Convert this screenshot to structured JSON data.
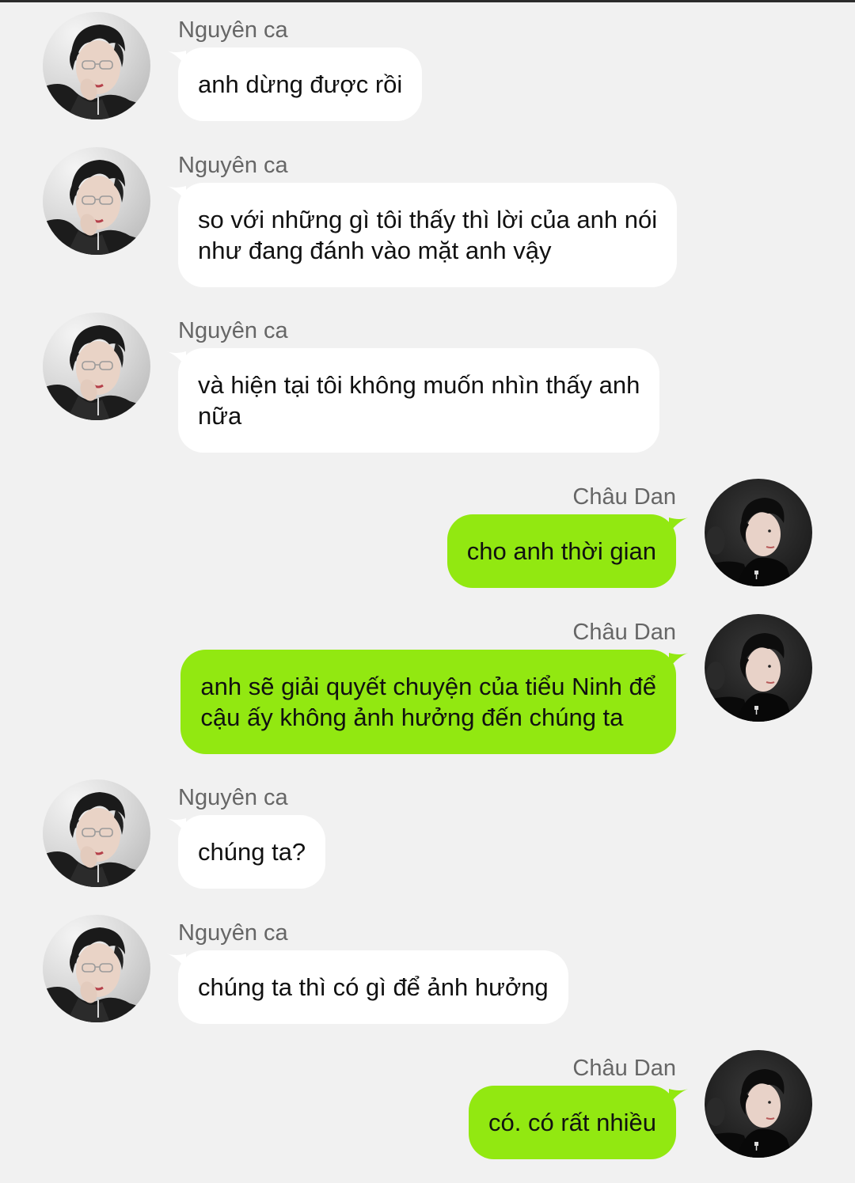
{
  "colors": {
    "background": "#f1f1f1",
    "incoming_bubble": "#ffffff",
    "outgoing_bubble": "#92e811",
    "sender_name": "#666666",
    "message_text": "#111111"
  },
  "messages": [
    {
      "side": "left",
      "sender": "Nguyên ca",
      "avatar": "contact-avatar",
      "lines": [
        "anh dừng được rồi"
      ]
    },
    {
      "side": "left",
      "sender": "Nguyên ca",
      "avatar": "contact-avatar",
      "lines": [
        "so với những gì tôi thấy thì lời của anh nói",
        "như đang đánh vào mặt anh vậy"
      ]
    },
    {
      "side": "left",
      "sender": "Nguyên ca",
      "avatar": "contact-avatar",
      "lines": [
        "và hiện tại tôi không muốn nhìn thấy anh",
        "nữa"
      ]
    },
    {
      "side": "right",
      "sender": "Châu Dan",
      "avatar": "self-avatar",
      "lines": [
        "cho anh thời gian"
      ]
    },
    {
      "side": "right",
      "sender": "Châu Dan",
      "avatar": "self-avatar",
      "lines": [
        "anh sẽ giải quyết chuyện của tiểu Ninh để",
        "cậu ấy không ảnh hưởng đến chúng ta"
      ]
    },
    {
      "side": "left",
      "sender": "Nguyên ca",
      "avatar": "contact-avatar",
      "lines": [
        "chúng ta?"
      ]
    },
    {
      "side": "left",
      "sender": "Nguyên ca",
      "avatar": "contact-avatar",
      "lines": [
        "chúng ta thì có gì để ảnh hưởng"
      ]
    },
    {
      "side": "right",
      "sender": "Châu Dan",
      "avatar": "self-avatar",
      "lines": [
        "có. có rất nhiều"
      ]
    }
  ]
}
